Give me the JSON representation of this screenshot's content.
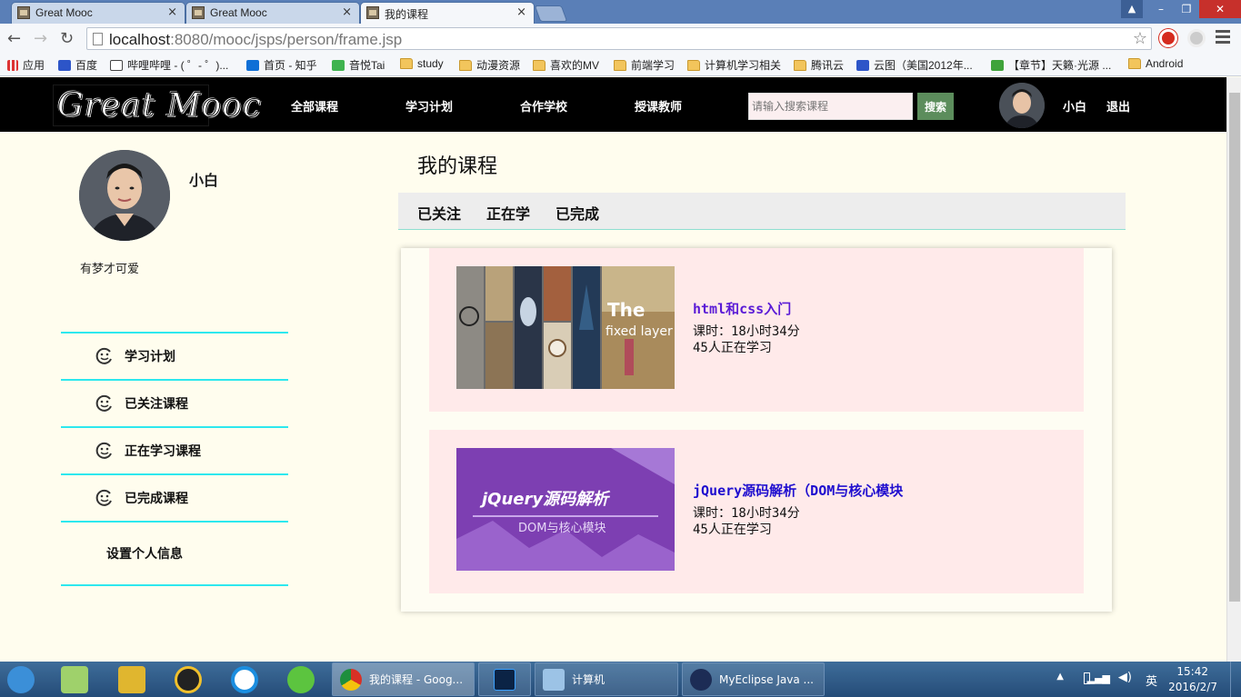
{
  "browser": {
    "tabs": [
      {
        "title": "Great Mooc",
        "close": "×"
      },
      {
        "title": "Great Mooc",
        "close": "×"
      },
      {
        "title": "我的课程",
        "close": "×"
      }
    ],
    "url_host": "localhost",
    "url_rest": ":8080/mooc/jsps/person/frame.jsp",
    "bookmarks": [
      "应用",
      "百度",
      "哔哩哔哩 - ( ゜- ゜)...",
      "首页 - 知乎",
      "音悦Tai",
      "study",
      "动漫资源",
      "喜欢的MV",
      "前端学习",
      "计算机学习相关",
      "腾讯云",
      "云图（美国2012年...",
      "【章节】天籁·光源 ...",
      "Android"
    ]
  },
  "header": {
    "logo_text": "Great Mooc",
    "nav": [
      "全部课程",
      "学习计划",
      "合作学校",
      "授课教师"
    ],
    "search_placeholder": "请输入搜索课程",
    "search_button": "搜索",
    "username": "小白",
    "logout": "退出"
  },
  "profile": {
    "name": "小白",
    "motto": "有梦才可爱"
  },
  "sidebar": {
    "items": [
      "学习计划",
      "已关注课程",
      "正在学习课程",
      "已完成课程",
      "设置个人信息"
    ]
  },
  "main": {
    "title": "我的课程",
    "tabs": [
      "已关注",
      "正在学",
      "已完成"
    ],
    "courses": [
      {
        "name": "html和css入门",
        "hours": "课时：18小时34分",
        "learners": "45人正在学习",
        "thumb_text_1": "The",
        "thumb_text_2": "fixed layer"
      },
      {
        "name": "jQuery源码解析（DOM与核心模块",
        "hours": "课时：18小时34分",
        "learners": "45人正在学习",
        "thumb_text_1": "jQuery源码解析",
        "thumb_text_2": "DOM与核心模块"
      }
    ]
  },
  "taskbar": {
    "tasks": [
      "我的课程 - Goog...",
      "计算机",
      "MyEclipse Java ..."
    ],
    "ime": "英",
    "time": "15:42",
    "date": "2016/2/7"
  }
}
